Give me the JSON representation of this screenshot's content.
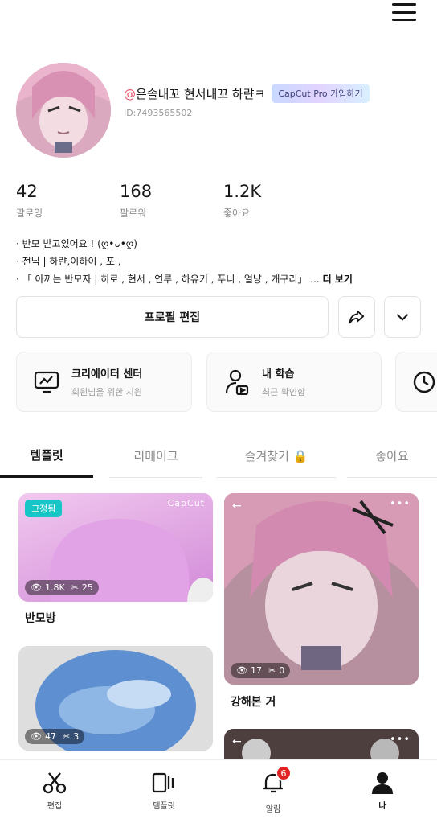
{
  "header": {
    "menu_icon": "hamburger-icon"
  },
  "profile": {
    "at": "@",
    "name": "은솔내꼬 현서내꼬 하랸ㅋ",
    "pro_badge": "CapCut Pro 가입하기",
    "user_id": "ID:7493565502"
  },
  "stats": [
    {
      "value": "42",
      "label": "팔로잉"
    },
    {
      "value": "168",
      "label": "팔로워"
    },
    {
      "value": "1.2K",
      "label": "좋아요"
    }
  ],
  "bio": {
    "line1": "· 반모 받고있어요 ! (ღ•ᴗ•ღ)",
    "line2": "· 전닉 | 하랸,이하이 , 포 ,",
    "line3": "·  「 아끼는 반모자 | 히로 , 현서 , 연루 , 하유키 , 푸니 , 얼냥 , 개구리」 ...",
    "more": "더 보기"
  },
  "actions": {
    "edit_profile": "프로필 편집",
    "share_icon": "share-arrow-icon",
    "more_icon": "chevron-down-icon"
  },
  "cards": [
    {
      "title": "크리에이터 센터",
      "subtitle": "회원님을 위한 지원",
      "icon": "monitor-chart-icon"
    },
    {
      "title": "내 학습",
      "subtitle": "최근 확인함",
      "icon": "person-play-icon"
    },
    {
      "title": "",
      "subtitle": "",
      "icon": "clock-icon"
    }
  ],
  "tabs": [
    {
      "label": "템플릿",
      "active": true
    },
    {
      "label": "리메이크",
      "active": false
    },
    {
      "label": "즐겨찾기 🔒",
      "active": false
    },
    {
      "label": "좋아요",
      "active": false
    }
  ],
  "templates": [
    {
      "title": "반모방",
      "views": "1.8K",
      "uses": "25",
      "pinned_label": "고정됨",
      "watermark": "CapCut"
    },
    {
      "title": "강해본 거",
      "views": "17",
      "uses": "0"
    },
    {
      "title": "",
      "views": "47",
      "uses": "3"
    },
    {
      "title": "",
      "views": "",
      "uses": ""
    }
  ],
  "bottom_nav": [
    {
      "label": "편집",
      "icon": "scissors-icon",
      "active": false
    },
    {
      "label": "템플릿",
      "icon": "template-icon",
      "active": false
    },
    {
      "label": "알림",
      "icon": "bell-icon",
      "badge": "6",
      "active": false
    },
    {
      "label": "나",
      "icon": "person-icon",
      "active": true
    }
  ],
  "colors": {
    "accent": "#16c6c7",
    "at_color": "#e5546c",
    "badge_red": "#e02424"
  }
}
